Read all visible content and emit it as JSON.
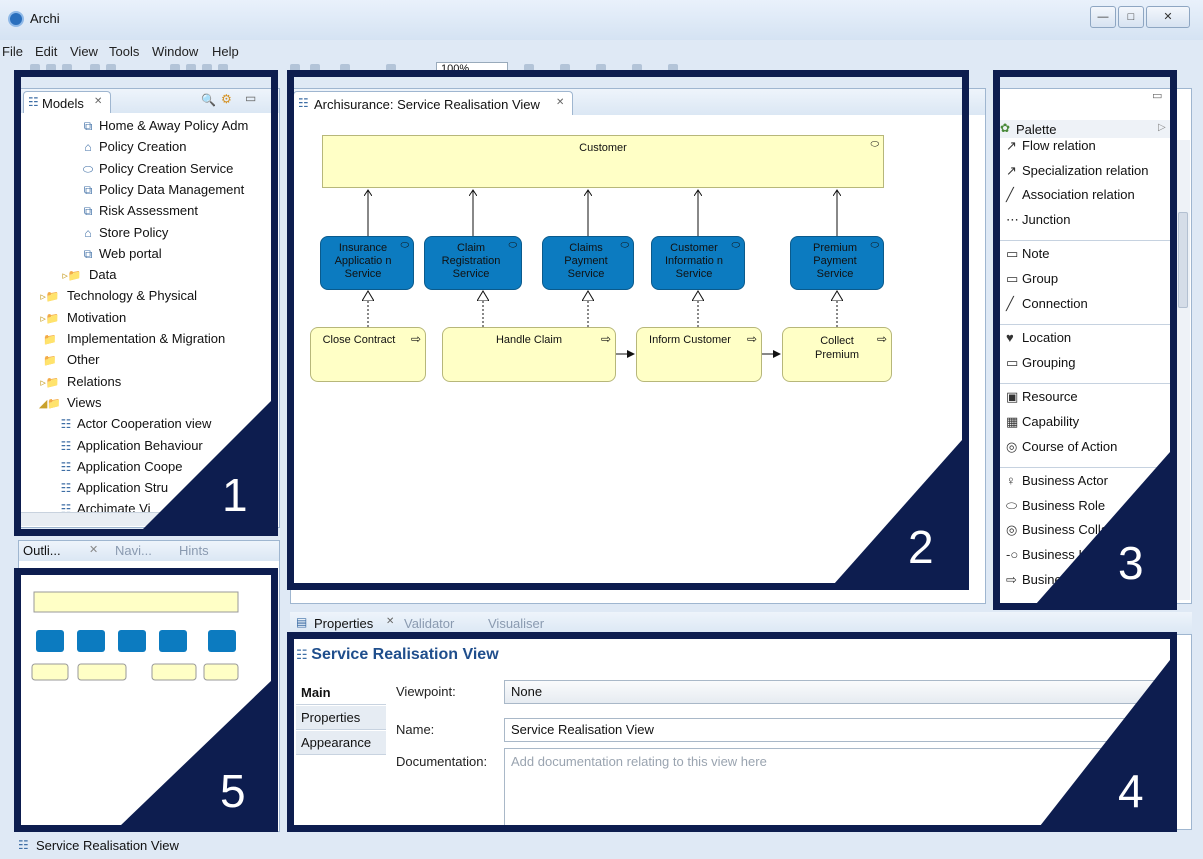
{
  "window": {
    "title": "Archi",
    "minimize": "—",
    "maximize": "□",
    "close": "✕"
  },
  "menu": [
    "File",
    "Edit",
    "View",
    "Tools",
    "Window",
    "Help"
  ],
  "toolbar": {
    "zoom": "100%"
  },
  "models_panel": {
    "tab": "Models",
    "tree": [
      {
        "icon": "component-icon",
        "glyph": "⧉",
        "label": "Home & Away Policy Adm",
        "indent": 3
      },
      {
        "icon": "function-icon",
        "glyph": "⌂",
        "label": "Policy Creation",
        "indent": 3
      },
      {
        "icon": "service-icon",
        "glyph": "⬭",
        "label": "Policy Creation Service",
        "indent": 3
      },
      {
        "icon": "component-icon",
        "glyph": "⧉",
        "label": "Policy Data Management",
        "indent": 3
      },
      {
        "icon": "component-icon",
        "glyph": "⧉",
        "label": "Risk Assessment",
        "indent": 3
      },
      {
        "icon": "function-icon",
        "glyph": "⌂",
        "label": "Store Policy",
        "indent": 3
      },
      {
        "icon": "component-icon",
        "glyph": "⧉",
        "label": "Web portal",
        "indent": 3
      },
      {
        "icon": "folder-icon",
        "glyph": "▹",
        "label": "Data",
        "indent": 2
      },
      {
        "icon": "folder-icon",
        "glyph": "▹",
        "label": "Technology & Physical",
        "indent": 1
      },
      {
        "icon": "folder-icon",
        "glyph": "▹",
        "label": "Motivation",
        "indent": 1
      },
      {
        "icon": "folder-icon",
        "glyph": "",
        "label": "Implementation & Migration",
        "indent": 1
      },
      {
        "icon": "folder-icon",
        "glyph": "",
        "label": "Other",
        "indent": 1
      },
      {
        "icon": "folder-icon",
        "glyph": "▹",
        "label": "Relations",
        "indent": 1
      },
      {
        "icon": "folder-icon",
        "glyph": "◢",
        "label": "Views",
        "indent": 1
      },
      {
        "icon": "view-icon",
        "glyph": "☷",
        "label": "Actor Cooperation view",
        "indent": 2
      },
      {
        "icon": "view-icon",
        "glyph": "☷",
        "label": "Application Behaviour",
        "indent": 2
      },
      {
        "icon": "view-icon",
        "glyph": "☷",
        "label": "Application Coope",
        "indent": 2
      },
      {
        "icon": "view-icon",
        "glyph": "☷",
        "label": "Application Stru",
        "indent": 2
      },
      {
        "icon": "view-icon",
        "glyph": "☷",
        "label": "Archimate Vi",
        "indent": 2
      }
    ]
  },
  "outline_panel": {
    "tabs": [
      "Outli...",
      "Navi...",
      "Hints"
    ]
  },
  "editor": {
    "tab": "Archisurance: Service Realisation View",
    "customer": "Customer",
    "services": [
      "Insurance Applicatio n Service",
      "Claim Registration Service",
      "Claims Payment Service",
      "Customer Informatio n Service",
      "Premium Payment Service"
    ],
    "processes": [
      "Close Contract",
      "Handle Claim",
      "Inform Customer",
      "Collect Premium"
    ]
  },
  "palette": {
    "title": "Palette",
    "groups": [
      [
        {
          "icon": "flow-relation-icon",
          "glyph": "↗",
          "label": "Flow relation"
        },
        {
          "icon": "specialization-relation-icon",
          "glyph": "↗",
          "label": "Specialization relation"
        },
        {
          "icon": "association-relation-icon",
          "glyph": "╱",
          "label": "Association relation"
        },
        {
          "icon": "junction-icon",
          "glyph": "⋯",
          "label": "Junction"
        }
      ],
      [
        {
          "icon": "note-icon",
          "glyph": "▭",
          "label": "Note"
        },
        {
          "icon": "group-icon",
          "glyph": "▭",
          "label": "Group"
        },
        {
          "icon": "connection-icon",
          "glyph": "╱",
          "label": "Connection"
        }
      ],
      [
        {
          "icon": "location-icon",
          "glyph": "♥",
          "label": "Location"
        },
        {
          "icon": "grouping-icon",
          "glyph": "▭",
          "label": "Grouping"
        }
      ],
      [
        {
          "icon": "resource-icon",
          "glyph": "▣",
          "label": "Resource"
        },
        {
          "icon": "capability-icon",
          "glyph": "▦",
          "label": "Capability"
        },
        {
          "icon": "course-of-action-icon",
          "glyph": "◎",
          "label": "Course of Action"
        }
      ],
      [
        {
          "icon": "business-actor-icon",
          "glyph": "♀",
          "label": "Business Actor"
        },
        {
          "icon": "business-role-icon",
          "glyph": "⬭",
          "label": "Business Role"
        },
        {
          "icon": "business-collaboration-icon",
          "glyph": "◎",
          "label": "Business Collab"
        },
        {
          "icon": "business-interface-icon",
          "glyph": "-○",
          "label": "Business Int"
        },
        {
          "icon": "business-process-icon",
          "glyph": "⇨",
          "label": "Busines"
        }
      ]
    ]
  },
  "properties": {
    "tabs": [
      "Properties",
      "Validator",
      "Visualiser"
    ],
    "title": "Service Realisation View",
    "side_tabs": [
      "Main",
      "Properties",
      "Appearance"
    ],
    "viewpoint_label": "Viewpoint:",
    "viewpoint_value": "None",
    "name_label": "Name:",
    "name_value": "Service Realisation View",
    "doc_label": "Documentation:",
    "doc_placeholder": "Add documentation relating to this view here"
  },
  "status_bar": {
    "text": "Service Realisation View"
  },
  "callouts": [
    "1",
    "2",
    "3",
    "4",
    "5"
  ],
  "colors": {
    "overlay": "#0d1d4f",
    "service": "#0c7bc0",
    "process": "#ffffc6",
    "accent": "#1f4e8c"
  }
}
